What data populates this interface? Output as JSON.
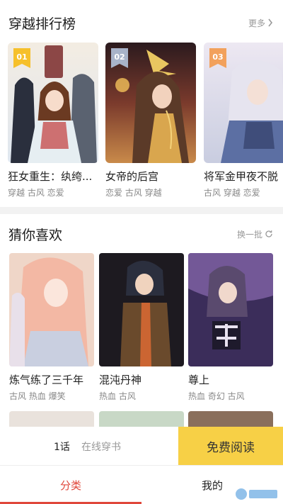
{
  "ranking": {
    "title": "穿越排行榜",
    "more_label": "更多",
    "items": [
      {
        "rank": "01",
        "title": "狂女重生：纨绔...",
        "tags": "穿越 古风 恋爱",
        "badge_color": "#f6c02b"
      },
      {
        "rank": "02",
        "title": "女帝的后宫",
        "tags": "恋爱 古风 穿越",
        "badge_color": "#a8b3c9"
      },
      {
        "rank": "03",
        "title": "将军金甲夜不脱",
        "tags": "古风 穿越 恋爱",
        "badge_color": "#f2a15c"
      }
    ]
  },
  "guess": {
    "title": "猜你喜欢",
    "refresh_label": "换一批",
    "items": [
      {
        "title": "炼气练了三千年",
        "tags": "古风  热血  爆笑"
      },
      {
        "title": "混沌丹神",
        "tags": "热血  古风"
      },
      {
        "title": "尊上",
        "tags": "热血  奇幻  古风"
      }
    ]
  },
  "read_bar": {
    "chapter": "1话",
    "hint": "在线穿书",
    "button_label": "免费阅读"
  },
  "tabs": [
    {
      "label": "分类"
    },
    {
      "label": "我的"
    }
  ],
  "colors": {
    "accent": "#e0473a",
    "button_yellow": "#f7d046"
  }
}
